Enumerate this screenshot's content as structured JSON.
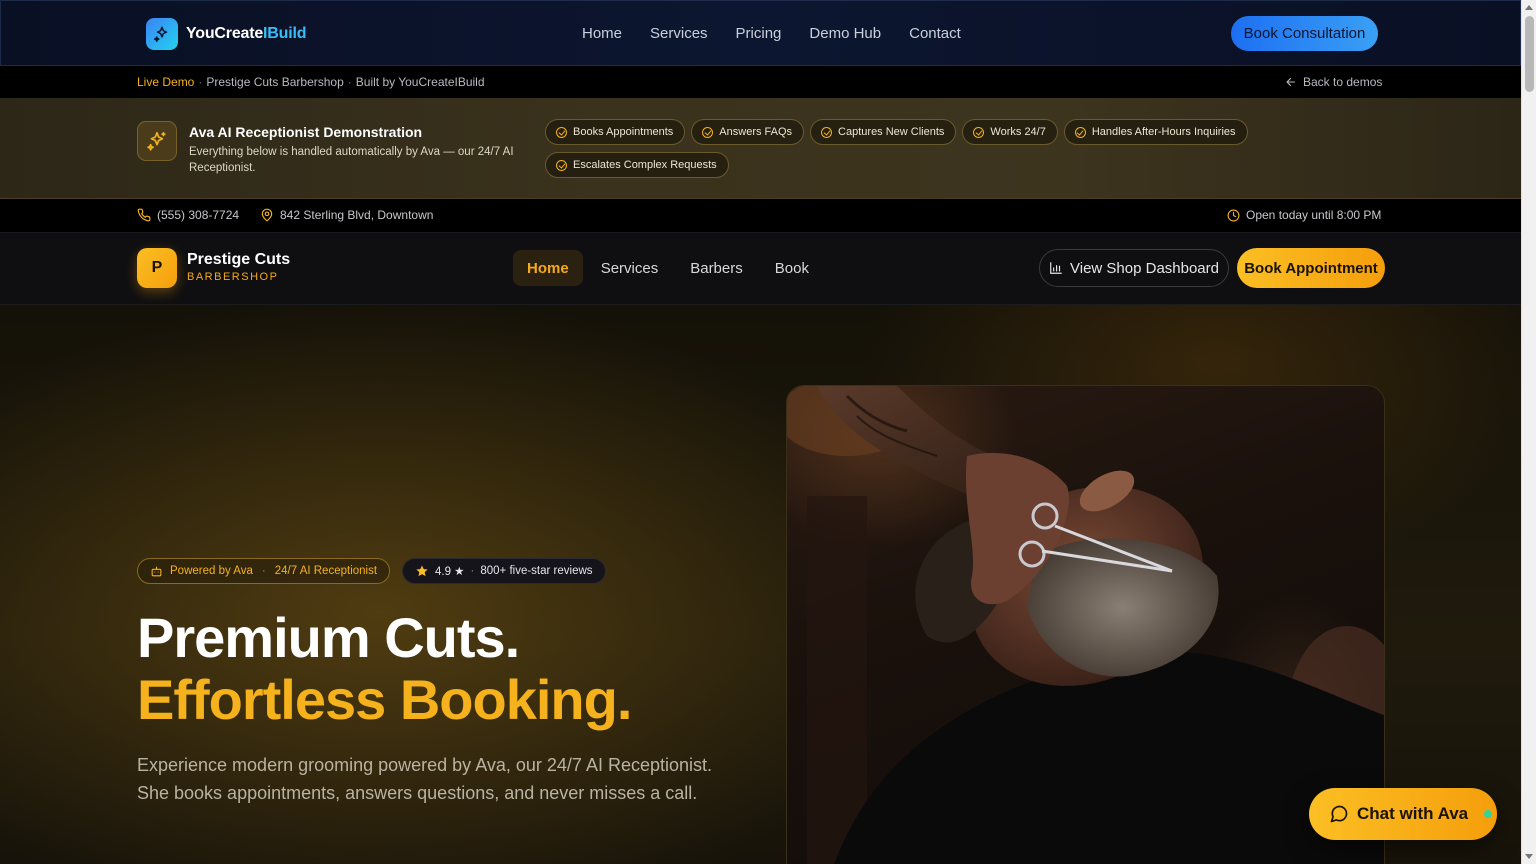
{
  "site": {
    "brand_main": "YouCreate",
    "brand_accent": "IBuild",
    "nav": [
      "Home",
      "Services",
      "Pricing",
      "Demo Hub",
      "Contact"
    ],
    "cta": "Book Consultation"
  },
  "demo_strip": {
    "live": "Live Demo",
    "shop": "Prestige Cuts Barbershop",
    "built_by": "Built by YouCreateIBuild",
    "separator": "·",
    "back": "Back to demos"
  },
  "ava_banner": {
    "title": "Ava AI Receptionist Demonstration",
    "description": "Everything below is handled automatically by Ava — our 24/7 AI Receptionist.",
    "features": [
      "Books Appointments",
      "Answers FAQs",
      "Captures New Clients",
      "Works 24/7",
      "Handles After-Hours Inquiries",
      "Escalates Complex Requests"
    ]
  },
  "contact": {
    "phone": "(555) 308-7724",
    "address": "842 Sterling Blvd, Downtown",
    "hours": "Open today until 8:00 PM"
  },
  "shop_nav": {
    "logo_letter": "P",
    "name": "Prestige Cuts",
    "subtitle": "BARBERSHOP",
    "links": [
      "Home",
      "Services",
      "Barbers",
      "Book"
    ],
    "active_link": "Home",
    "dashboard_button": "View Shop Dashboard",
    "book_button": "Book Appointment"
  },
  "hero": {
    "powered_by": "Powered by Ava",
    "receptionist": "24/7 AI Receptionist",
    "rating": "4.9 ★",
    "reviews": "800+ five-star reviews",
    "title_line1": "Premium Cuts.",
    "title_line2": "Effortless Booking.",
    "description": "Experience modern grooming powered by Ava, our 24/7 AI Receptionist. She books appointments, answers questions, and never misses a call.",
    "image_alt": "barber-trimming-beard-photo"
  },
  "chat": {
    "label": "Chat with Ava",
    "status": "online"
  },
  "colors": {
    "accent_gold": "#f5b21c",
    "brand_blue": "#3b82f6",
    "online_green": "#34d399"
  }
}
